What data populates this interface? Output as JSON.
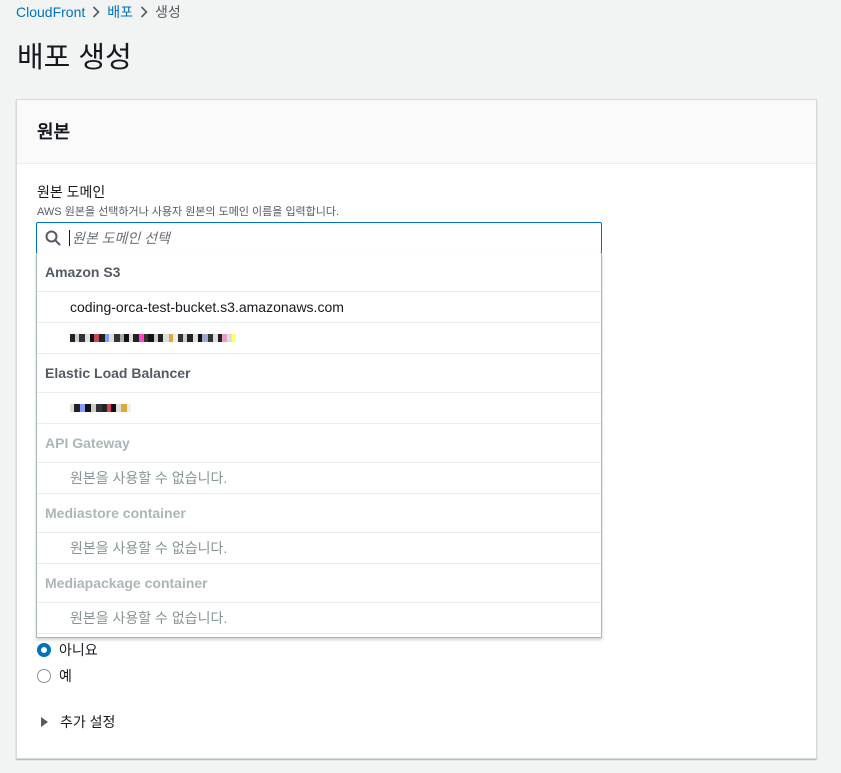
{
  "breadcrumb": {
    "items": [
      "CloudFront",
      "배포"
    ],
    "current": "생성"
  },
  "page": {
    "title": "배포 생성"
  },
  "panel": {
    "title": "원본",
    "field": {
      "label": "원본 도메인",
      "description": "AWS 원본을 선택하거나 사용자 원본의 도메인 이름을 입력합니다.",
      "placeholder": "원본 도메인 선택",
      "value": ""
    },
    "dropdown": {
      "groups": [
        {
          "label": "Amazon S3",
          "options": [
            "coding-orca-test-bucket.s3.amazonaws.com"
          ]
        },
        {
          "label": "Elastic Load Balancer",
          "options": []
        },
        {
          "label": "API Gateway",
          "options": [
            "원본을 사용할 수 없습니다."
          ]
        },
        {
          "label": "Mediastore container",
          "options": [
            "원본을 사용할 수 없습니다."
          ]
        },
        {
          "label": "Mediapackage container",
          "options": [
            "원본을 사용할 수 없습니다."
          ]
        }
      ]
    },
    "radios": [
      {
        "label": "아니요",
        "checked": true
      },
      {
        "label": "예",
        "checked": false
      }
    ],
    "expander": {
      "label": "추가 설정"
    }
  },
  "colors": {
    "link": "#0073bb",
    "accent": "#0073bb"
  }
}
